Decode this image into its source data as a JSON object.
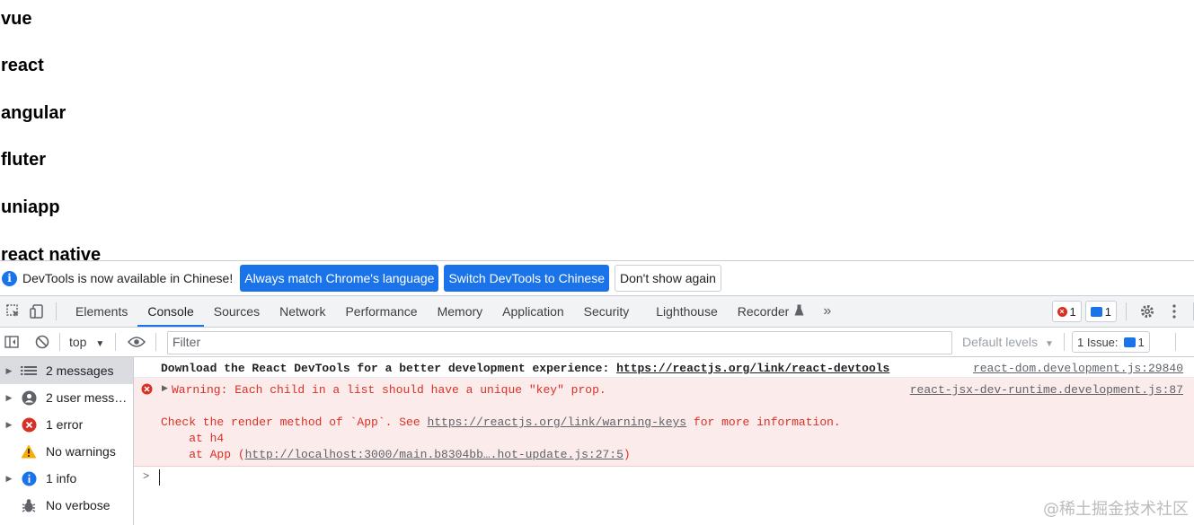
{
  "page": {
    "headings": [
      "vue",
      "react",
      "angular",
      "fluter",
      "uniapp",
      "react native"
    ]
  },
  "infobar": {
    "message": "DevTools is now available in Chinese!",
    "btn_match": "Always match Chrome's language",
    "btn_switch": "Switch DevTools to Chinese",
    "btn_dismiss": "Don't show again"
  },
  "tabs": [
    "Elements",
    "Console",
    "Sources",
    "Network",
    "Performance",
    "Memory",
    "Application",
    "Security",
    "Lighthouse",
    "Recorder"
  ],
  "active_tab": "Console",
  "toolbar": {
    "error_count": "1",
    "message_count": "1"
  },
  "filterbar": {
    "context": "top",
    "filter_placeholder": "Filter",
    "levels": "Default levels",
    "issues_label": "1 Issue:",
    "issues_count": "1"
  },
  "sidebar": {
    "items": [
      {
        "label": "2 messages"
      },
      {
        "label": "2 user mess…"
      },
      {
        "label": "1 error"
      },
      {
        "label": "No warnings"
      },
      {
        "label": "1 info"
      },
      {
        "label": "No verbose"
      }
    ]
  },
  "console": {
    "log": {
      "text": "Download the React DevTools for a better development experience: ",
      "link": "https://reactjs.org/link/react-devtools",
      "source": "react-dom.development.js:29840"
    },
    "error": {
      "line1": "Warning: Each child in a list should have a unique \"key\" prop.",
      "source": "react-jsx-dev-runtime.development.js:87",
      "line2_pre": "Check the render method of `App`. See ",
      "line2_link": "https://reactjs.org/link/warning-keys",
      "line2_post": " for more information.",
      "line3": "    at h4",
      "line4_pre": "    at App (",
      "line4_link": "http://localhost:3000/main.b8304bb….hot-update.js:27:5",
      "line4_post": ")"
    }
  },
  "watermark": "@稀土掘金技术社区",
  "colors": {
    "accent": "#1a73e8",
    "error": "#d93025",
    "error_bg": "#fcebeb",
    "toolbar_bg": "#f1f3f4"
  }
}
